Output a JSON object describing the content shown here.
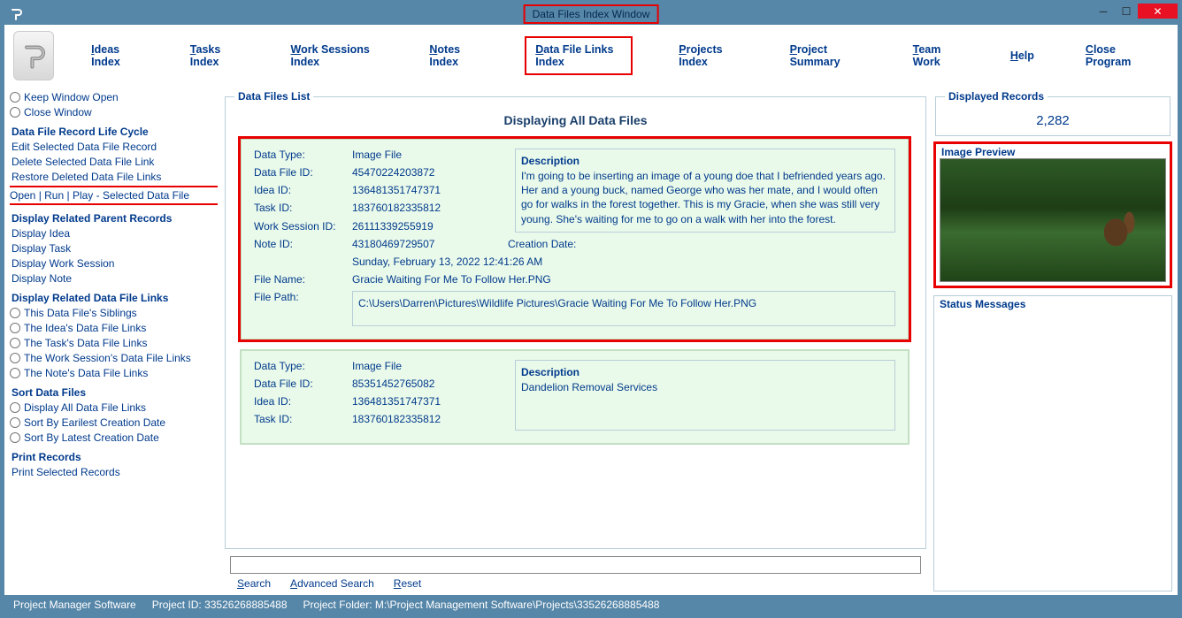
{
  "window": {
    "title": "Data Files Index Window"
  },
  "menu": {
    "ideas": "Ideas Index",
    "tasks": "Tasks Index",
    "work_sessions": "Work Sessions Index",
    "notes": "Notes Index",
    "datafile_links": "Data File Links Index",
    "projects": "Projects Index",
    "project_summary": "Project Summary",
    "team_work": "Team Work",
    "help": "Help",
    "close": "Close Program"
  },
  "sidebar": {
    "keep_window_open": "Keep Window Open",
    "close_window": "Close Window",
    "lifecycle_header": "Data File Record Life Cycle",
    "edit_record": "Edit Selected Data File Record",
    "delete_link": "Delete Selected Data File Link",
    "restore_links": "Restore Deleted Data File Links",
    "open_run_play": "Open | Run | Play - Selected Data File",
    "parent_header": "Display Related Parent Records",
    "display_idea": "Display Idea",
    "display_task": "Display Task",
    "display_ws": "Display Work Session",
    "display_note": "Display Note",
    "related_links_header": "Display Related Data File Links",
    "siblings": "This Data File's Siblings",
    "idea_links": "The Idea's Data File Links",
    "task_links": "The Task's Data File Links",
    "ws_links": "The Work Session's Data File Links",
    "note_links": "The Note's Data File Links",
    "sort_header": "Sort Data Files",
    "sort_all": "Display All Data File Links",
    "sort_earliest": "Sort By Earilest Creation Date",
    "sort_latest": "Sort By Latest Creation Date",
    "print_header": "Print Records",
    "print_selected": "Print Selected Records"
  },
  "list": {
    "legend": "Data Files List",
    "heading": "Displaying All Data Files"
  },
  "records": [
    {
      "data_type": "Image File",
      "data_file_id": "45470224203872",
      "idea_id": "136481351747371",
      "task_id": "183760182335812",
      "ws_id": "26111339255919",
      "note_id": "43180469729507",
      "creation_date": "Sunday, February 13, 2022   12:41:26 AM",
      "file_name": "Gracie Waiting For Me To Follow Her.PNG",
      "file_path": "C:\\Users\\Darren\\Pictures\\Wildlife Pictures\\Gracie Waiting For Me To Follow Her.PNG",
      "description": "I'm going to be inserting an image of a young doe that I befriended years ago. Her and a young buck, named George who was her mate, and I would often go for walks in the forest together. This is my Gracie, when she was still very young. She's waiting for me to go on a walk with her into the forest."
    },
    {
      "data_type": "Image File",
      "data_file_id": "85351452765082",
      "idea_id": "136481351747371",
      "task_id": "183760182335812",
      "description": "Dandelion Removal Services"
    }
  ],
  "labels": {
    "data_type": "Data Type:",
    "data_file_id": "Data File ID:",
    "idea_id": "Idea ID:",
    "task_id": "Task ID:",
    "ws_id": "Work Session ID:",
    "note_id": "Note ID:",
    "creation_date": "Creation Date:",
    "file_name": "File Name:",
    "file_path": "File Path:",
    "description": "Description"
  },
  "search": {
    "search": "Search",
    "advanced": "Advanced Search",
    "reset": "Reset"
  },
  "right": {
    "displayed_legend": "Displayed Records",
    "count": "2,282",
    "image_preview": "Image Preview",
    "status_legend": "Status Messages"
  },
  "footer": {
    "app": "Project Manager Software",
    "project_id": "Project ID:  33526268885488",
    "project_folder": "Project Folder:  M:\\Project Management Software\\Projects\\33526268885488"
  }
}
